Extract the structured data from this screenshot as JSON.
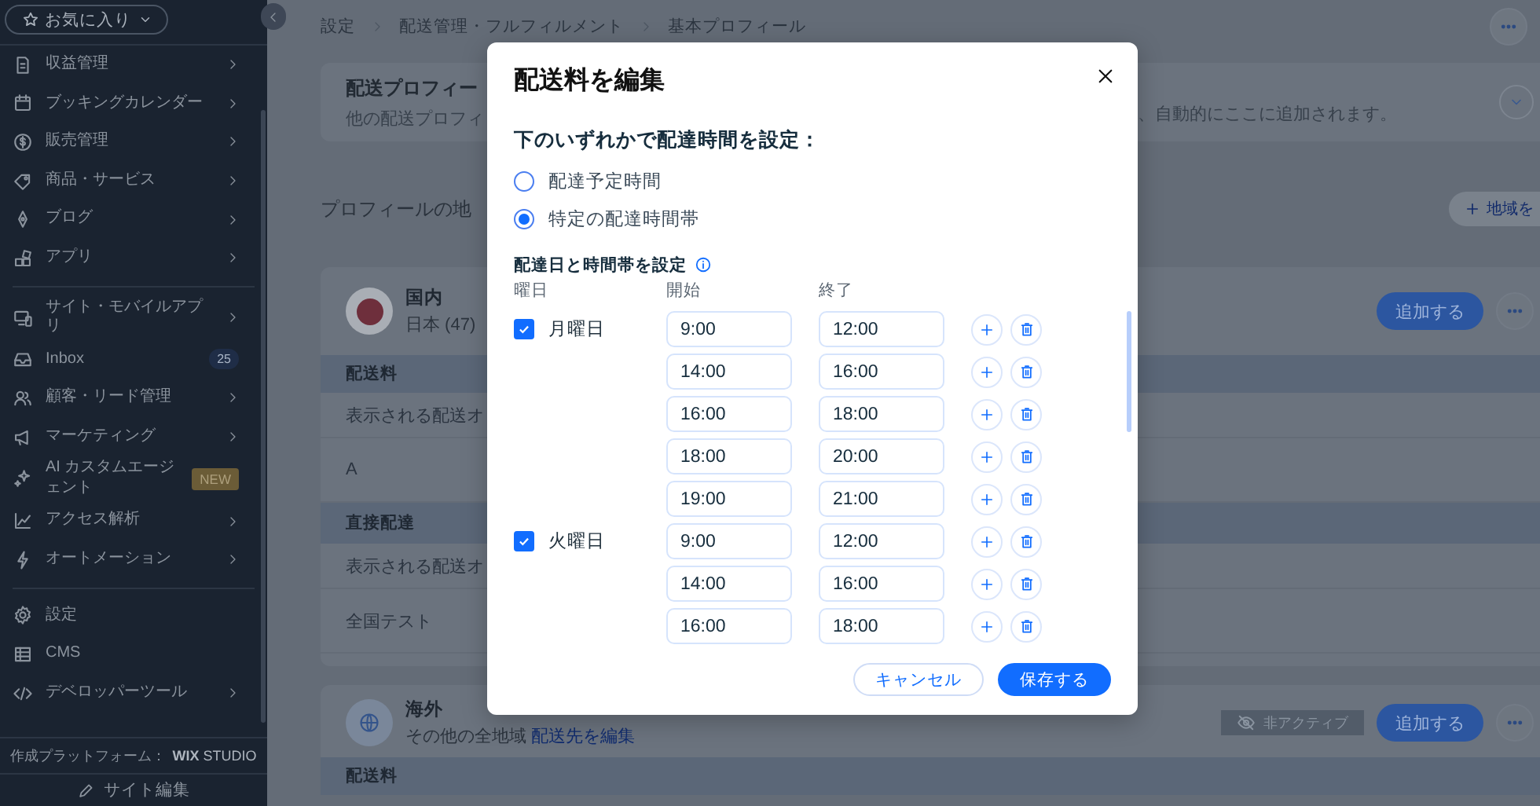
{
  "sidebar": {
    "favorites_button": "お気に入り",
    "groups": [
      [
        {
          "label": "収益管理",
          "has_submenu": true
        },
        {
          "label": "ブッキングカレンダー",
          "has_submenu": true
        },
        {
          "label": "販売管理",
          "has_submenu": true
        },
        {
          "label": "商品・サービス",
          "has_submenu": true
        },
        {
          "label": "ブログ",
          "has_submenu": true
        },
        {
          "label": "アプリ",
          "has_submenu": true
        }
      ],
      [
        {
          "label": "サイト・モバイルアプリ",
          "has_submenu": true
        },
        {
          "label": "Inbox",
          "has_submenu": false,
          "badge": {
            "kind": "count",
            "text": "25"
          }
        },
        {
          "label": "顧客・リード管理",
          "has_submenu": true
        },
        {
          "label": "マーケティング",
          "has_submenu": true
        },
        {
          "label": "AI カスタムエージェント",
          "has_submenu": false,
          "badge": {
            "kind": "new",
            "text": "NEW"
          }
        },
        {
          "label": "アクセス解析",
          "has_submenu": true
        },
        {
          "label": "オートメーション",
          "has_submenu": true
        }
      ],
      [
        {
          "label": "設定",
          "has_submenu": false
        },
        {
          "label": "CMS",
          "has_submenu": false
        },
        {
          "label": "デベロッパーツール",
          "has_submenu": true
        }
      ]
    ],
    "credit": "作成プラットフォーム：",
    "logo": "**WIX** STUDIO",
    "edit_site_button": "サイト編集"
  },
  "breadcrumb": [
    "設定",
    "配送管理・フルフィルメント",
    "基本プロフィール"
  ],
  "profile_card": {
    "title": "配送プロフィー",
    "description_start": "他の配送プロフィ",
    "description_end": "、自動的にここに追加されます。"
  },
  "regions_heading": "プロフィールの地",
  "create_region_button": "地域を",
  "regions": [
    {
      "kind": "flag",
      "name": "国内",
      "detail": "日本 (47)",
      "add_button": "追加する",
      "sections": [
        {
          "header": "配送料",
          "rows": [
            "表示される配送オ",
            "A"
          ]
        },
        {
          "header": "直接配達",
          "rows": [
            "表示される配送オ",
            "全国テスト"
          ]
        }
      ]
    },
    {
      "kind": "globe",
      "name": "海外",
      "detail": "その他の全地域",
      "link": "配送先を編集",
      "status_badge": "非アクティブ",
      "add_button": "追加する",
      "sections": [
        {
          "header": "配送料"
        }
      ]
    }
  ],
  "dialog": {
    "title": "配送料を編集",
    "prompt": "下のいずれかで配達時間を設定：",
    "options": [
      {
        "label": "配達予定時間",
        "selected": false
      },
      {
        "label": "特定の配達時間帯",
        "selected": true
      }
    ],
    "schedule_label": "配達日と時間帯を設定",
    "columns": [
      "曜日",
      "開始",
      "終了"
    ],
    "days": [
      {
        "label": "月曜日",
        "checked": true,
        "slots": [
          {
            "start": "9:00",
            "end": "12:00"
          },
          {
            "start": "14:00",
            "end": "16:00"
          },
          {
            "start": "16:00",
            "end": "18:00"
          },
          {
            "start": "18:00",
            "end": "20:00"
          },
          {
            "start": "19:00",
            "end": "21:00"
          }
        ]
      },
      {
        "label": "火曜日",
        "checked": true,
        "slots": [
          {
            "start": "9:00",
            "end": "12:00"
          },
          {
            "start": "14:00",
            "end": "16:00"
          },
          {
            "start": "16:00",
            "end": "18:00"
          }
        ]
      }
    ],
    "cancel_button": "キャンセル",
    "save_button": "保存する"
  }
}
